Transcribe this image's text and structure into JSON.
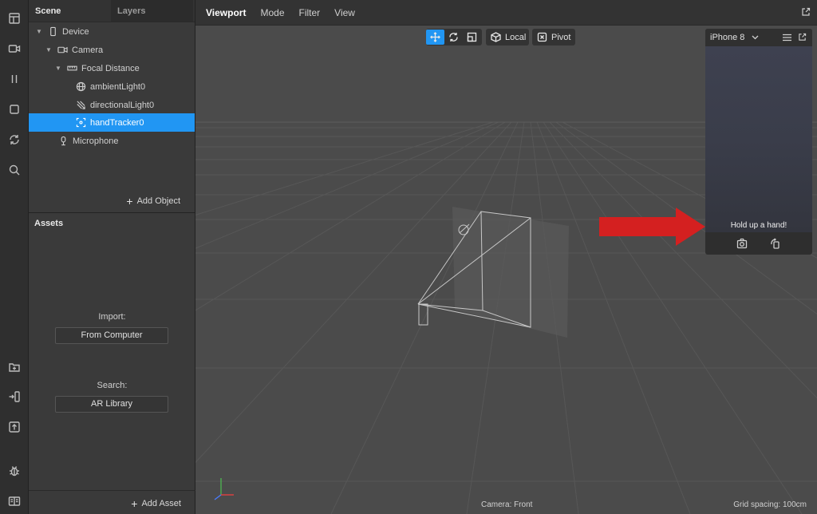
{
  "rail": {
    "icons": [
      "layout-icon",
      "video-icon",
      "pause-icon",
      "square-icon",
      "refresh-icon",
      "search-icon",
      "add-file-icon",
      "send-to-device-icon",
      "upload-icon",
      "bug-icon",
      "book-icon"
    ]
  },
  "scene": {
    "tabs": [
      {
        "label": "Scene"
      },
      {
        "label": "Layers"
      }
    ],
    "items": [
      {
        "label": "Device",
        "icon": "device-icon"
      },
      {
        "label": "Camera",
        "icon": "camera-icon"
      },
      {
        "label": "Focal Distance",
        "icon": "ruler-icon"
      },
      {
        "label": "ambientLight0",
        "icon": "globe-icon"
      },
      {
        "label": "directionalLight0",
        "icon": "directional-light-icon"
      },
      {
        "label": "handTracker0",
        "icon": "hand-tracker-icon"
      },
      {
        "label": "Microphone",
        "icon": "microphone-icon"
      }
    ],
    "add_object": "Add Object"
  },
  "assets": {
    "title": "Assets",
    "import_label": "Import:",
    "import_button": "From Computer",
    "search_label": "Search:",
    "search_button": "AR Library",
    "add_asset": "Add Asset"
  },
  "viewport": {
    "menus": [
      {
        "label": "Viewport"
      },
      {
        "label": "Mode"
      },
      {
        "label": "Filter"
      },
      {
        "label": "View"
      }
    ],
    "tools": {
      "local_label": "Local",
      "pivot_label": "Pivot"
    },
    "status_camera": "Camera: Front",
    "status_grid": "Grid spacing: 100cm"
  },
  "simulator": {
    "device": "iPhone 8",
    "message": "Hold up a hand!"
  },
  "colors": {
    "accent": "#2196f3",
    "arrow": "#d42020"
  }
}
